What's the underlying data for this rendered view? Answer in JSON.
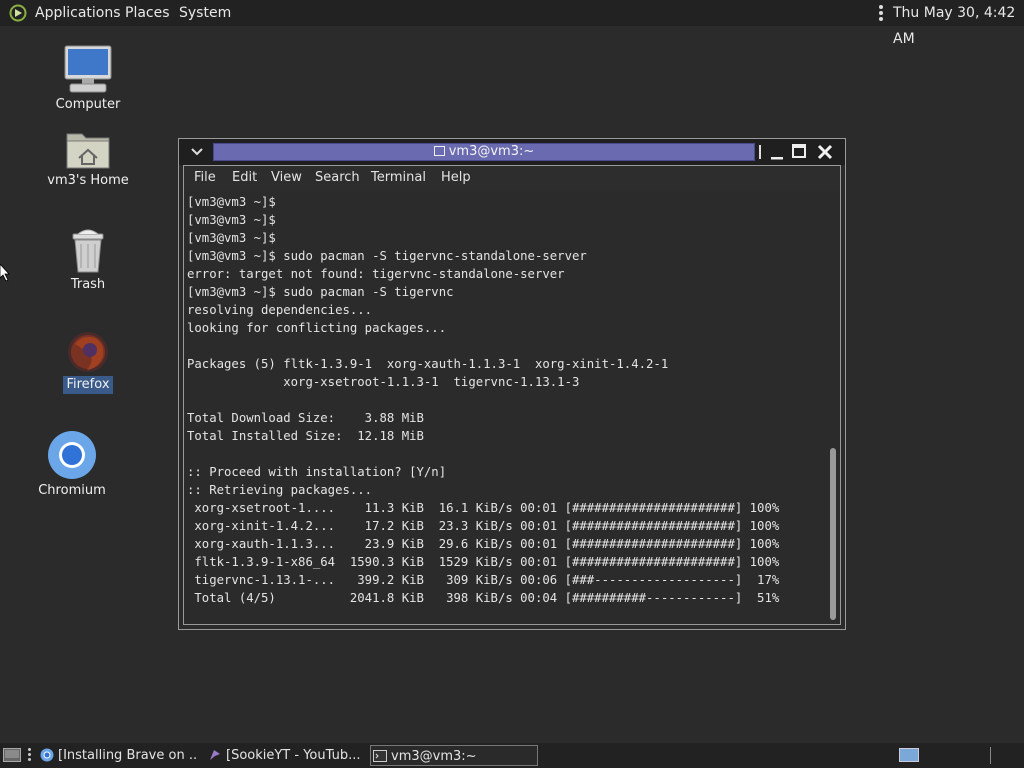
{
  "top_panel": {
    "applications": "Applications",
    "places": "Places",
    "system": "System",
    "clock": "Thu May 30,  4:42 AM"
  },
  "desktop_icons": {
    "computer": "Computer",
    "home": "vm3's Home",
    "trash": "Trash",
    "firefox": "Firefox",
    "chromium": "Chromium"
  },
  "terminal": {
    "title": "vm3@vm3:~",
    "menu": [
      "File",
      "Edit",
      "View",
      "Search",
      "Terminal",
      "Help"
    ],
    "output": "[vm3@vm3 ~]$\n[vm3@vm3 ~]$\n[vm3@vm3 ~]$\n[vm3@vm3 ~]$ sudo pacman -S tigervnc-standalone-server\nerror: target not found: tigervnc-standalone-server\n[vm3@vm3 ~]$ sudo pacman -S tigervnc\nresolving dependencies...\nlooking for conflicting packages...\n\nPackages (5) fltk-1.3.9-1  xorg-xauth-1.1.3-1  xorg-xinit-1.4.2-1\n             xorg-xsetroot-1.1.3-1  tigervnc-1.13.1-3\n\nTotal Download Size:    3.88 MiB\nTotal Installed Size:  12.18 MiB\n\n:: Proceed with installation? [Y/n]\n:: Retrieving packages...\n xorg-xsetroot-1....    11.3 KiB  16.1 KiB/s 00:01 [######################] 100%\n xorg-xinit-1.4.2...    17.2 KiB  23.3 KiB/s 00:01 [######################] 100%\n xorg-xauth-1.1.3...    23.9 KiB  29.6 KiB/s 00:01 [######################] 100%\n fltk-1.3.9-1-x86_64  1590.3 KiB  1529 KiB/s 00:01 [######################] 100%\n tigervnc-1.13.1-...   399.2 KiB   309 KiB/s 00:06 [###-------------------]  17%\n Total (4/5)          2041.8 KiB   398 KiB/s 00:04 [##########------------]  51%"
  },
  "taskbar": {
    "tasks": [
      "[Installing Brave on ...",
      "[SookieYT - YouTub...",
      "vm3@vm3:~"
    ]
  },
  "colors": {
    "desktop_bg": "#2b2b2b",
    "panel_bg": "#222222",
    "title_accent": "#6a6ab0",
    "selection": "#3a5a8a"
  }
}
